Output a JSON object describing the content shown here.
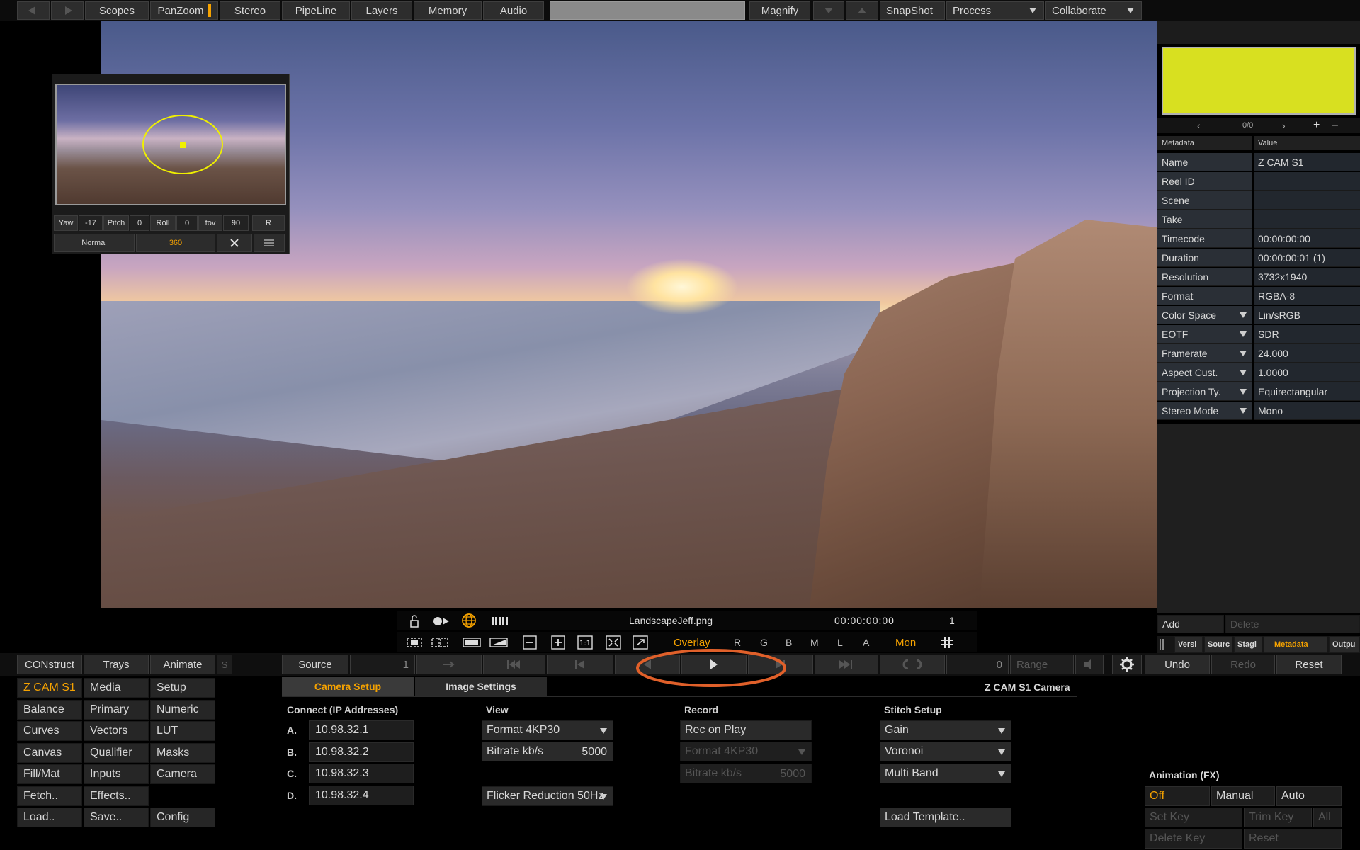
{
  "toolbar": {
    "items": [
      "Scopes",
      "PanZoom",
      "Stereo",
      "PipeLine",
      "Layers",
      "Memory",
      "Audio"
    ],
    "magnify": "Magnify",
    "snapshot": "SnapShot",
    "process": "Process",
    "collaborate": "Collaborate"
  },
  "panzoom": {
    "yaw_label": "Yaw",
    "yaw": "-17",
    "pitch_label": "Pitch",
    "pitch": "0",
    "roll_label": "Roll",
    "roll": "0",
    "fov_label": "fov",
    "fov": "90",
    "reset": "R",
    "normal": "Normal",
    "mode360": "360"
  },
  "right_panel": {
    "nav_count": "0/0",
    "plus": "+",
    "minus": "–",
    "head_key": "Metadata",
    "head_value": "Value",
    "rows": [
      {
        "key": "Name",
        "value": "Z CAM S1",
        "dropdown": false
      },
      {
        "key": "Reel ID",
        "value": "",
        "dropdown": false
      },
      {
        "key": "Scene",
        "value": "",
        "dropdown": false
      },
      {
        "key": "Take",
        "value": "",
        "dropdown": false
      },
      {
        "key": "Timecode",
        "value": "00:00:00:00",
        "dropdown": false
      },
      {
        "key": "Duration",
        "value": "00:00:00:01 (1)",
        "dropdown": false
      },
      {
        "key": "Resolution",
        "value": "3732x1940",
        "dropdown": false
      },
      {
        "key": "Format",
        "value": "RGBA-8",
        "dropdown": false
      },
      {
        "key": "Color Space",
        "value": "Lin/sRGB",
        "dropdown": true
      },
      {
        "key": "EOTF",
        "value": "SDR",
        "dropdown": true
      },
      {
        "key": "Framerate",
        "value": "24.000",
        "dropdown": true
      },
      {
        "key": "Aspect Cust.",
        "value": "1.0000",
        "dropdown": true
      },
      {
        "key": "Projection Ty.",
        "value": "Equirectangular",
        "dropdown": true
      },
      {
        "key": "Stereo Mode",
        "value": "Mono",
        "dropdown": true
      }
    ],
    "add": "Add",
    "delete": "Delete",
    "tabs": [
      "Versi",
      "Sourc",
      "Stagi",
      "Metadata",
      "Outpu"
    ]
  },
  "transport": {
    "filename": "LandscapeJeff.png",
    "timecode": "00:00:00:00",
    "frame": "1",
    "overlay": "Overlay",
    "channels": [
      "R",
      "G",
      "B",
      "M",
      "L",
      "A"
    ],
    "mon": "Mon"
  },
  "bar3": {
    "construct": "CONstruct",
    "trays": "Trays",
    "animate": "Animate",
    "s": "S",
    "source": "Source",
    "start": "1",
    "end": "0",
    "range": "Range",
    "undo": "Undo",
    "redo": "Redo",
    "reset": "Reset"
  },
  "left_menu": [
    [
      "Z CAM S1",
      "Media",
      "Setup"
    ],
    [
      "Balance",
      "Primary",
      "Numeric"
    ],
    [
      "Curves",
      "Vectors",
      "LUT"
    ],
    [
      "Canvas",
      "Qualifier",
      "Masks"
    ],
    [
      "Fill/Mat",
      "Inputs",
      "Camera"
    ],
    [
      "Fetch..",
      "Effects..",
      ""
    ],
    [
      "Load..",
      "Save..",
      "Config"
    ]
  ],
  "camera": {
    "tab1": "Camera Setup",
    "tab2": "Image Settings",
    "title": "Z CAM S1 Camera",
    "connect_head": "Connect (IP Addresses)",
    "ips": [
      {
        "label": "A.",
        "value": "10.98.32.1"
      },
      {
        "label": "B.",
        "value": "10.98.32.2"
      },
      {
        "label": "C.",
        "value": "10.98.32.3"
      },
      {
        "label": "D.",
        "value": "10.98.32.4"
      }
    ],
    "view_head": "View",
    "view_format": "Format 4KP30",
    "view_bitrate_label": "Bitrate kb/s",
    "view_bitrate": "5000",
    "flicker": "Flicker Reduction 50Hz",
    "record_head": "Record",
    "rec_on_play": "Rec on Play",
    "rec_format": "Format 4KP30",
    "rec_bitrate_label": "Bitrate kb/s",
    "rec_bitrate": "5000",
    "stitch_head": "Stitch Setup",
    "gain": "Gain",
    "voronoi": "Voronoi",
    "multiband": "Multi Band",
    "load_template": "Load Template.."
  },
  "anim": {
    "head": "Animation (FX)",
    "off": "Off",
    "manual": "Manual",
    "auto": "Auto",
    "set_key": "Set Key",
    "trim_key": "Trim Key",
    "all": "All",
    "delete_key": "Delete Key",
    "reset": "Reset"
  },
  "colors": {
    "accent": "#f5a200",
    "swatch": "#d8e020",
    "highlight_ring": "#e0602a"
  }
}
